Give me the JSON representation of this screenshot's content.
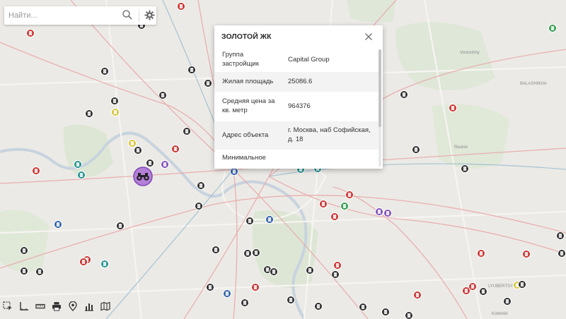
{
  "search": {
    "placeholder": "Найти..."
  },
  "map": {
    "labels": [
      "Vostochny",
      "BALASHIKHA",
      "Reutov",
      "LYUBERTSY",
      "Kotelniki"
    ],
    "selected_marker_icon": "binoculars-icon",
    "colors": {
      "black": "#2b2b2b",
      "red": "#c8302e",
      "teal": "#1f8f8c",
      "blue": "#2f5fa8",
      "purple": "#7d4bb6",
      "yellow": "#d7c43a",
      "green": "#2e9a4e",
      "selected": "#b57ed8"
    }
  },
  "popup": {
    "title": "ЗОЛОТОЙ ЖК",
    "rows": [
      {
        "label": "Группа застройщик",
        "value": "Capital Group"
      },
      {
        "label": "Жилая площадь",
        "value": "25086.6"
      },
      {
        "label": "Средняя цена за кв. метр",
        "value": "964376"
      },
      {
        "label": "Адрес объекта",
        "value": "г. Москва, наб Софийская, д. 18"
      },
      {
        "label": "Минимальное",
        "value": ""
      }
    ]
  },
  "toolbar": {
    "tools": [
      "select-tool-icon",
      "measure-tool-icon",
      "ruler-icon",
      "print-icon",
      "location-pin-icon",
      "chart-icon",
      "layers-icon"
    ]
  }
}
